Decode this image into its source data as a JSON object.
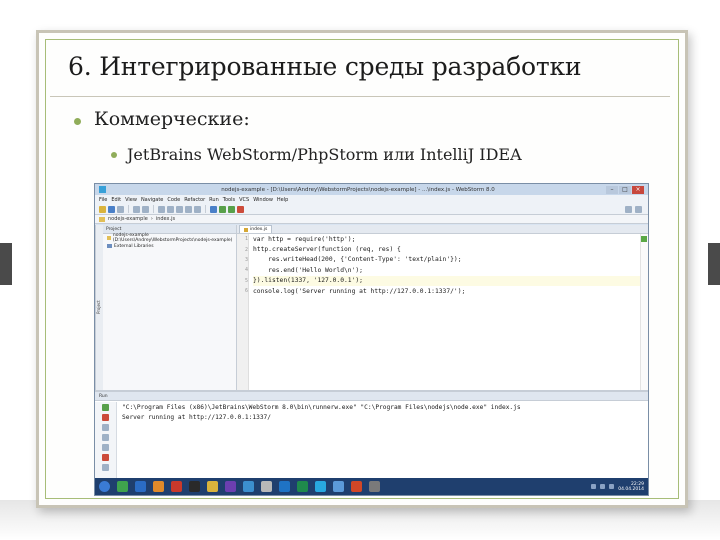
{
  "slide": {
    "title": "6. Интегрированные среды разработки",
    "bullet1": "Коммерческие:",
    "bullet2": "JetBrains WebStorm/PhpStorm или IntelliJ IDEA"
  },
  "ide": {
    "window_title": "nodejs-example - [D:\\Users\\Andrey\\WebstormProjects\\nodejs-example] - ...\\index.js - WebStorm 8.0",
    "menu": [
      "File",
      "Edit",
      "View",
      "Navigate",
      "Code",
      "Refactor",
      "Run",
      "Tools",
      "VCS",
      "Window",
      "Help"
    ],
    "breadcrumbs": [
      "nodejs-example",
      "index.js"
    ],
    "project_panel_label": "Project",
    "tree": [
      {
        "label": "nodejs-example (D:\\Users\\Andrey\\WebstormProjects\\nodejs-example)",
        "icon": "folder-icon"
      },
      {
        "label": "External Libraries",
        "icon": "library-icon"
      }
    ],
    "editor_tab": "index.js",
    "code_lines": [
      {
        "num": "1",
        "text": "var http = require('http');"
      },
      {
        "num": "2",
        "text": "http.createServer(function (req, res) {"
      },
      {
        "num": "3",
        "text": "    res.writeHead(200, {'Content-Type': 'text/plain'});"
      },
      {
        "num": "4",
        "text": "    res.end('Hello World\\n');"
      },
      {
        "num": "5",
        "text": "}).listen(1337, '127.0.0.1');"
      },
      {
        "num": "6",
        "text": "console.log('Server running at http://127.0.0.1:1337/');"
      }
    ],
    "run_panel_label": "Run",
    "console_lines": [
      "\"C:\\Program Files (x86)\\JetBrains\\WebStorm 8.0\\bin\\runnerw.exe\" \"C:\\Program Files\\nodejs\\node.exe\" index.js",
      "Server running at http://127.0.0.1:1337/"
    ],
    "clock_time": "22:29",
    "clock_date": "04.04.2014"
  },
  "colors": {
    "bullet": "#90ad5a",
    "frame_border": "#a7bd78",
    "taskbar": "#1f3f6e"
  }
}
